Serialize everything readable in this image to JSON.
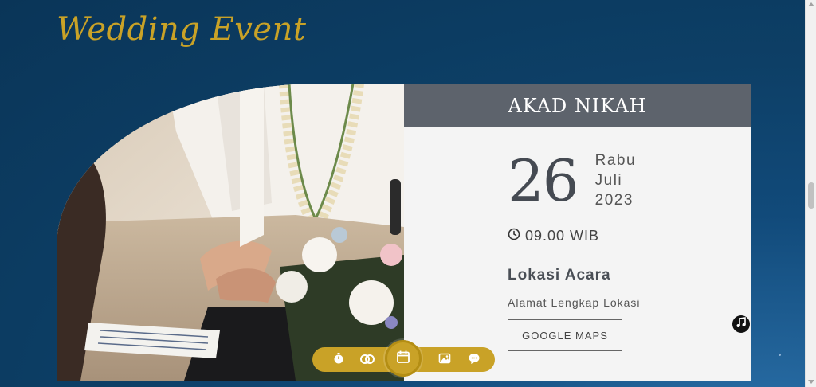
{
  "section": {
    "title": "Wedding Event"
  },
  "event": {
    "header": "AKAD NIKAH",
    "day": "26",
    "weekday": "Rabu",
    "month": "Juli",
    "year": "2023",
    "time": "09.00 WIB",
    "location_title": "Lokasi Acara",
    "location_address": "Alamat Lengkap Lokasi",
    "maps_button": "GOOGLE MAPS"
  },
  "colors": {
    "accent_gold": "#c9a227",
    "card_header": "#5d636c",
    "background_blue": "#0d3f66"
  },
  "nav": {
    "items": [
      {
        "icon": "stopwatch-icon"
      },
      {
        "icon": "couple-rings-icon"
      },
      {
        "icon": "calendar-icon",
        "active": true
      },
      {
        "icon": "gallery-icon"
      },
      {
        "icon": "chat-bubble-icon"
      }
    ]
  },
  "music": {
    "icon": "music-note-icon"
  }
}
